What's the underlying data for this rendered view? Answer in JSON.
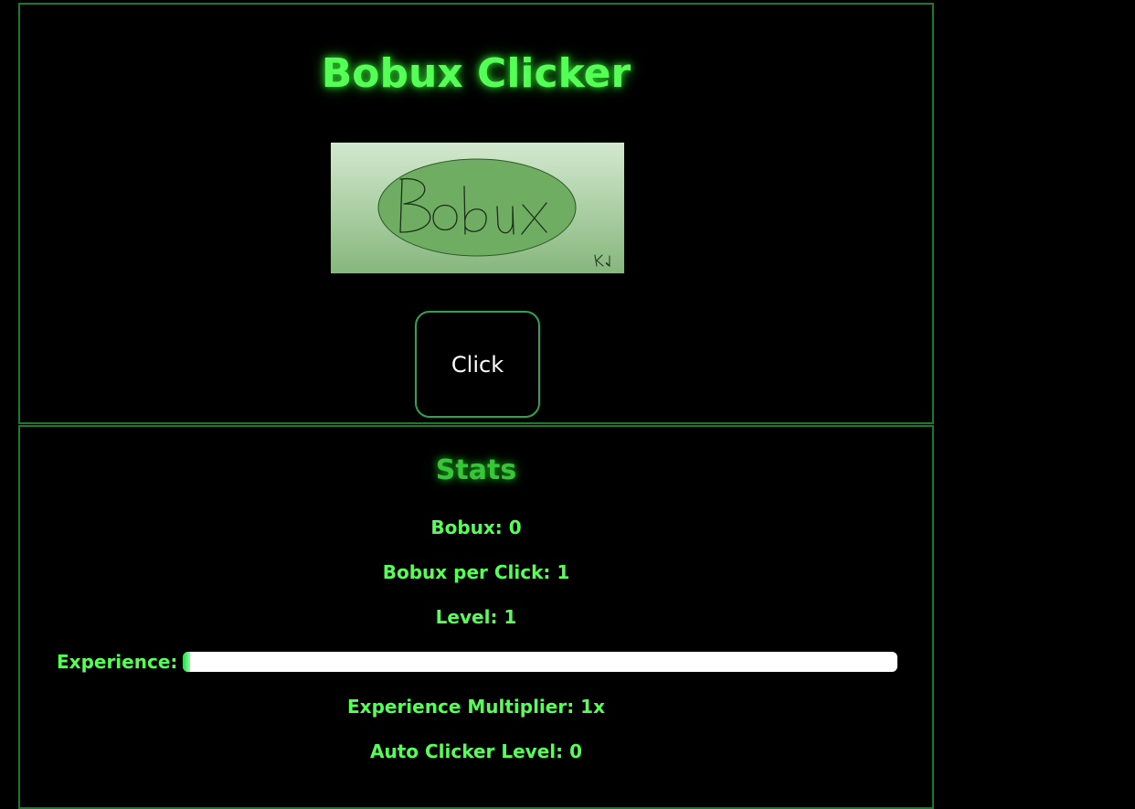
{
  "game": {
    "title": "Bobux Clicker",
    "logo_text": "Bobux",
    "logo_signature": "Kd",
    "click_label": "Click"
  },
  "stats": {
    "heading": "Stats",
    "bobux": "Bobux: 0",
    "bobux_per_click": "Bobux per Click: 1",
    "level": "Level: 1",
    "experience_label": "Experience:",
    "experience_progress": 0.01,
    "experience_multiplier": "Experience Multiplier: 1x",
    "auto_clicker_level": "Auto Clicker Level: 0"
  },
  "colors": {
    "background": "#000000",
    "accent": "#55ff55",
    "border": "#1a7a2a",
    "progress_fill": "#1fdc4a",
    "logo_green": "#6aab5e"
  }
}
